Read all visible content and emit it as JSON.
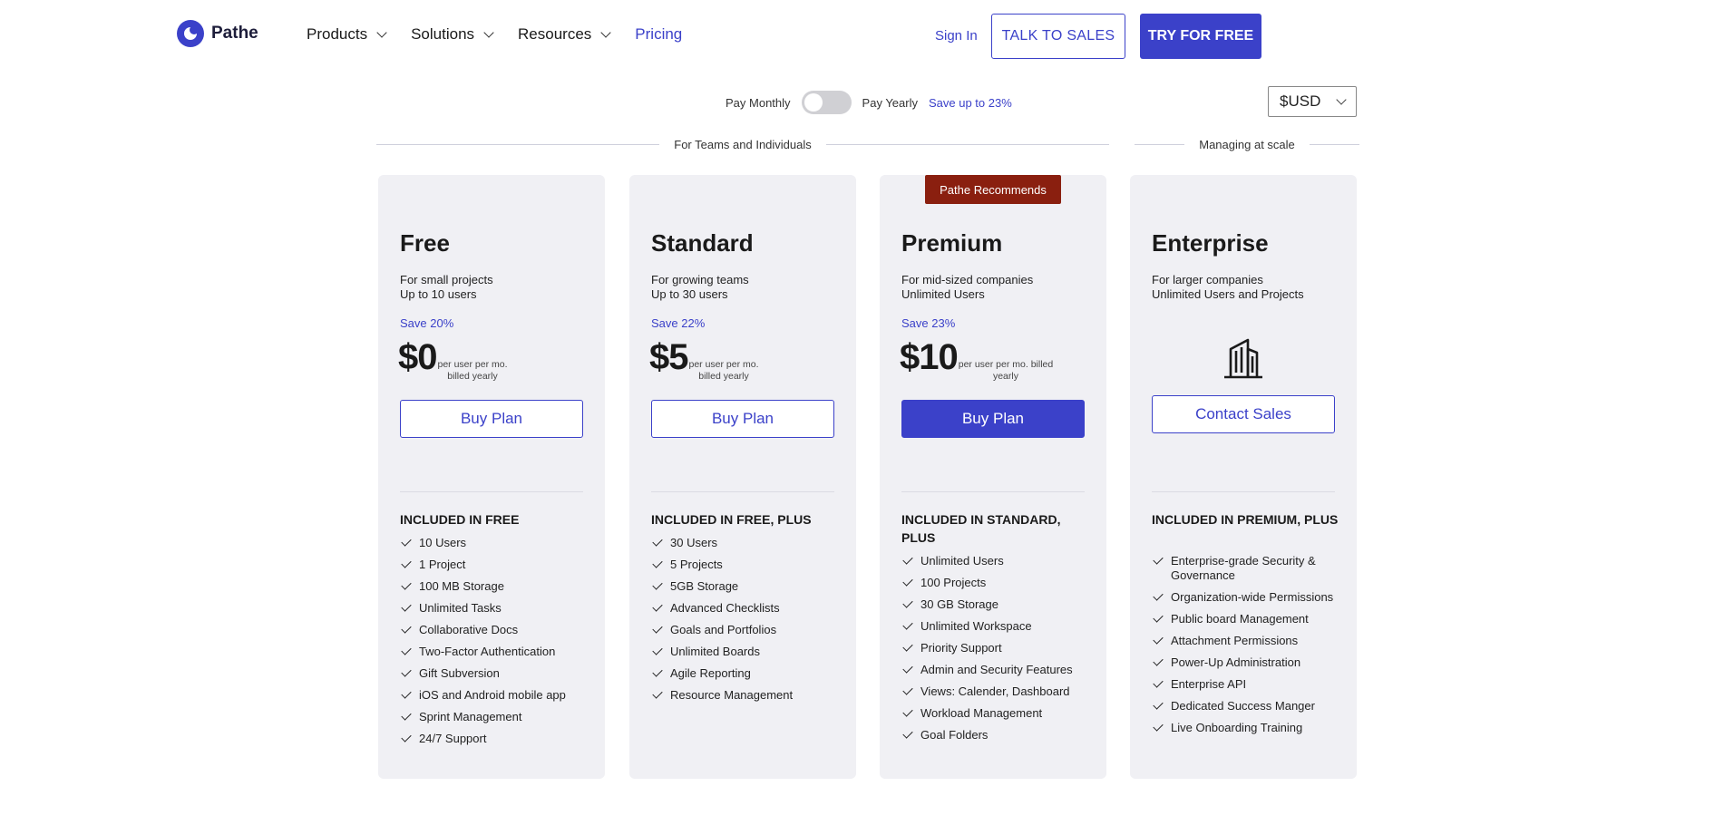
{
  "brand": {
    "name": "Pathe"
  },
  "nav": {
    "items": [
      {
        "label": "Products",
        "dropdown": true
      },
      {
        "label": "Solutions",
        "dropdown": true
      },
      {
        "label": "Resources",
        "dropdown": true
      },
      {
        "label": "Pricing",
        "dropdown": false
      }
    ],
    "signin": "Sign In",
    "talk_to_sales": "TALK TO SALES",
    "try_free": "TRY FOR FREE"
  },
  "billing": {
    "monthly_label": "Pay Monthly",
    "yearly_label": "Pay Yearly",
    "save_note": "Save up to 23%",
    "currency": "$USD"
  },
  "groups": {
    "teams": "For Teams and Individuals",
    "scale": "Managing at scale"
  },
  "plans": [
    {
      "name": "Free",
      "desc": [
        "For small projects",
        "Up to 10 users"
      ],
      "save": "Save 20%",
      "price": "$0",
      "price_note": [
        "per user per mo.",
        "billed yearly"
      ],
      "cta": "Buy Plan",
      "included_title": "INCLUDED IN FREE",
      "features": [
        "10 Users",
        "1 Project",
        "100 MB Storage",
        "Unlimited Tasks",
        "Collaborative Docs",
        "Two-Factor Authentication",
        "Gift Subversion",
        "iOS and Android mobile app",
        "Sprint Management",
        "24/7 Support"
      ]
    },
    {
      "name": "Standard",
      "desc": [
        "For growing teams",
        "Up to 30 users"
      ],
      "save": "Save 22%",
      "price": "$5",
      "price_note": [
        "per user per mo.",
        "billed yearly"
      ],
      "cta": "Buy Plan",
      "included_title": "INCLUDED IN FREE, PLUS",
      "features": [
        "30 Users",
        "5 Projects",
        "5GB Storage",
        "Advanced Checklists",
        "Goals and Portfolios",
        "Unlimited Boards",
        "Agile Reporting",
        "Resource Management"
      ]
    },
    {
      "name": "Premium",
      "badge": "Pathe Recommends",
      "desc": [
        "For mid-sized companies",
        "Unlimited Users"
      ],
      "save": "Save 23%",
      "price": "$10",
      "price_note": [
        "per user per mo. billed",
        "yearly"
      ],
      "cta": "Buy Plan",
      "included_title": "INCLUDED IN STANDARD, PLUS",
      "features": [
        "Unlimited Users",
        "100 Projects",
        "30 GB Storage",
        "Unlimited Workspace",
        "Priority Support",
        "Admin and Security Features",
        "Views: Calender, Dashboard",
        "Workload Management",
        "Goal Folders"
      ]
    },
    {
      "name": "Enterprise",
      "desc": [
        "For larger companies",
        "Unlimited Users and Projects"
      ],
      "icon": "building-icon",
      "cta": "Contact Sales",
      "included_title": "INCLUDED IN PREMIUM, PLUS",
      "features": [
        "Enterprise-grade Security & Governance",
        "Organization-wide Permissions",
        "Public board Management",
        "Attachment Permissions",
        "Power-Up Administration",
        "Enterprise API",
        "Dedicated Success Manger",
        "Live Onboarding Training"
      ]
    }
  ],
  "colors": {
    "accent": "#3b41c9",
    "badge": "#8a1f0f",
    "card": "#f0f0f4"
  }
}
